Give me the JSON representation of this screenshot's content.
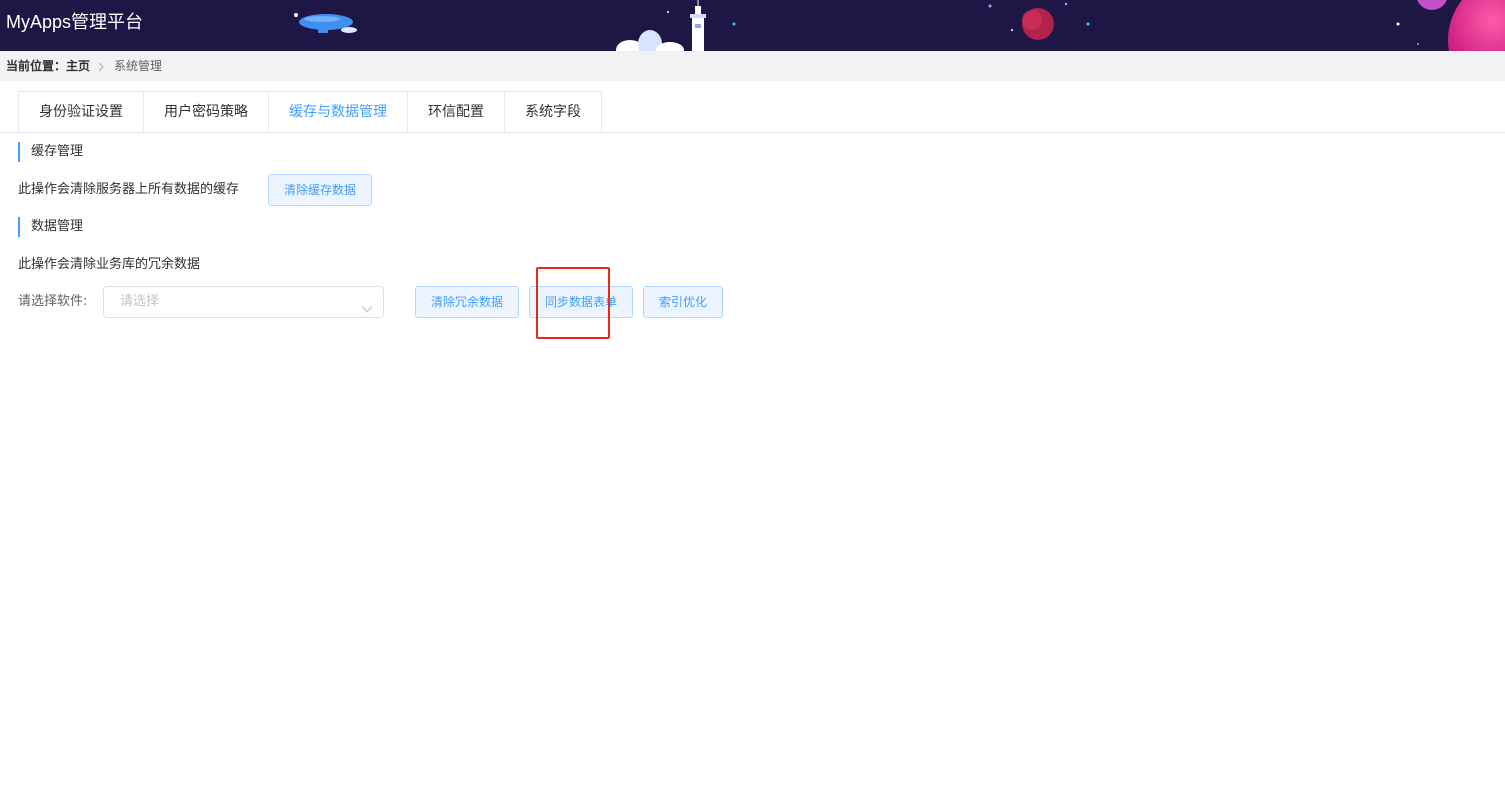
{
  "header": {
    "app_title": "MyApps管理平台"
  },
  "breadcrumb": {
    "prefix": "当前位置：",
    "home": "主页",
    "current": "系统管理"
  },
  "tabs": [
    {
      "label": "身份验证设置"
    },
    {
      "label": "用户密码策略"
    },
    {
      "label": "缓存与数据管理",
      "active": true
    },
    {
      "label": "环信配置"
    },
    {
      "label": "系统字段"
    }
  ],
  "cache_section": {
    "title": "缓存管理",
    "description": "此操作会清除服务器上所有数据的缓存",
    "clear_cache_button": "清除缓存数据"
  },
  "data_section": {
    "title": "数据管理",
    "description": "此操作会清除业务库的冗余数据",
    "software_label": "请选择软件:",
    "software_select_placeholder": "请选择",
    "buttons": {
      "clear_redundant": "清除冗余数据",
      "sync_tables": "同步数据表单",
      "index_optimize": "索引优化"
    }
  },
  "colors": {
    "header_bg": "#1e1645",
    "accent": "#409eff",
    "highlight": "#e8291c"
  }
}
